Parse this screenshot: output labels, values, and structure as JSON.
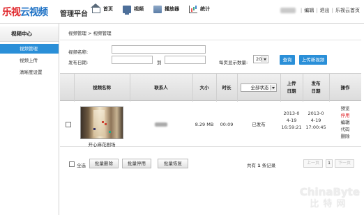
{
  "header": {
    "logo_red": "乐视",
    "logo_blue": "云视频",
    "platform": "管理平台",
    "nav": [
      {
        "label": "首页",
        "icon": "home-icon"
      },
      {
        "label": "视频",
        "icon": "video-icon"
      },
      {
        "label": "播放器",
        "icon": "player-icon"
      },
      {
        "label": "统计",
        "icon": "stats-icon"
      }
    ],
    "user_links": [
      "编辑",
      "退出",
      "乐视云首页"
    ]
  },
  "sidebar": {
    "title": "视频中心",
    "items": [
      {
        "label": "视频管理",
        "active": true
      },
      {
        "label": "视频上传",
        "active": false
      },
      {
        "label": "清晰度设置",
        "active": false
      }
    ]
  },
  "breadcrumb": "视频管理 > 视频管理",
  "search": {
    "name_label": "视频名称:",
    "date_label": "发布日期:",
    "to_label": "到",
    "per_page_label": "每页显示数量:",
    "per_page_value": "20",
    "query_button": "查询",
    "upload_button": "上传新视频"
  },
  "table": {
    "headers": [
      "视频名称",
      "联系人",
      "大小",
      "时长",
      "全部状态",
      "上传日期",
      "发布日期",
      "操作"
    ],
    "rows": [
      {
        "name": "开心麻花剧场",
        "size": "8.29 MB",
        "duration": "00:09",
        "status": "已发布",
        "upload_date": "2013-04-19",
        "upload_time": "16:59:21",
        "publish_date": "2013-04-19",
        "publish_time": "17:00:45",
        "actions": [
          "预览",
          "停用",
          "编辑",
          "代码",
          "删除"
        ]
      }
    ]
  },
  "bulk": {
    "select_all": "全选",
    "delete": "批量删除",
    "disable": "批量停用",
    "restore": "批量恢复"
  },
  "pager": {
    "prefix": "共有",
    "count": "1",
    "suffix": "条记录",
    "prev": "上一页",
    "current": "1",
    "next": "下一页"
  },
  "watermark": {
    "line1": "ChinaByte",
    "line2": "比特网"
  },
  "colors": {
    "accent": "#2a8fd8",
    "logo_red": "#e0262b",
    "logo_blue": "#1a6fc4"
  }
}
